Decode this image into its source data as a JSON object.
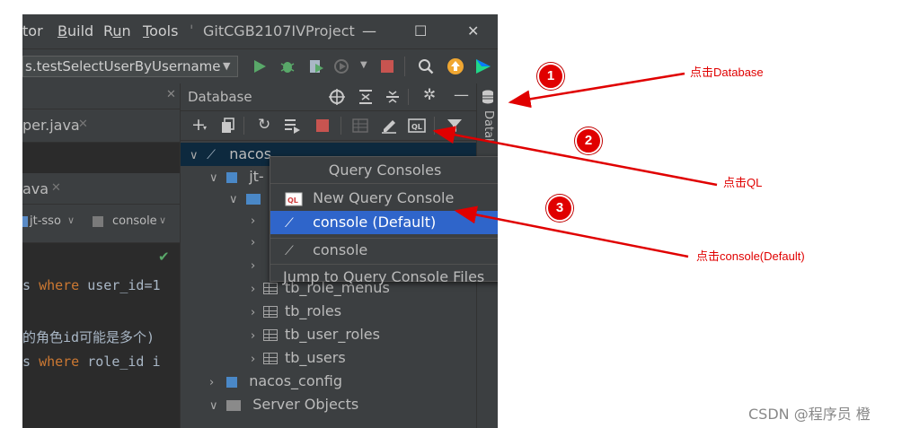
{
  "menubar": {
    "items": [
      {
        "label": "tor"
      },
      {
        "label": "Build",
        "mnemonic": "B",
        "rest": "uild"
      },
      {
        "label": "Run",
        "mnemonic": "u",
        "pre": "R",
        "rest": "n"
      },
      {
        "label": "Tools",
        "mnemonic": "T",
        "rest": "ools"
      }
    ],
    "project_title": "GitCGB2107IVProject",
    "minimize": "—",
    "maximize": "☐",
    "close": "✕"
  },
  "runbar": {
    "run_config": "s.testSelectUserByUsername",
    "run_config_arrow": "▼"
  },
  "editor": {
    "tab1": "per.java",
    "tab2": "ava",
    "breadcrumb1": "jt-sso",
    "breadcrumb2": "console",
    "code_line1_pre": "s ",
    "code_line1_kw": "where",
    "code_line1_post": " user_id=1",
    "comment_line": "的角色id可能是多个)",
    "code_line2_pre": "s ",
    "code_line2_kw": "where",
    "code_line2_post": " role_id i",
    "check": "✔"
  },
  "panel": {
    "title": "Database",
    "strip_label": "Datal"
  },
  "tree": {
    "root": "nacos",
    "schema": "jt-",
    "tables": [
      "tb_role_menus",
      "tb_roles",
      "tb_user_roles",
      "tb_users"
    ],
    "nacos_config": "nacos_config",
    "server_objects": "Server Objects"
  },
  "popup": {
    "title": "Query Consoles",
    "items": [
      {
        "label": "New Query Console"
      },
      {
        "label": "console (Default)"
      },
      {
        "label": "console"
      },
      {
        "label": "Jump to Query Console Files"
      }
    ]
  },
  "annotations": {
    "badge1": "1",
    "badge2": "2",
    "badge3": "3",
    "note1": "点击Database",
    "note2": "点击QL",
    "note3": "点击console(Default)",
    "color": "#e00000"
  },
  "watermark": "CSDN @程序员 橙"
}
